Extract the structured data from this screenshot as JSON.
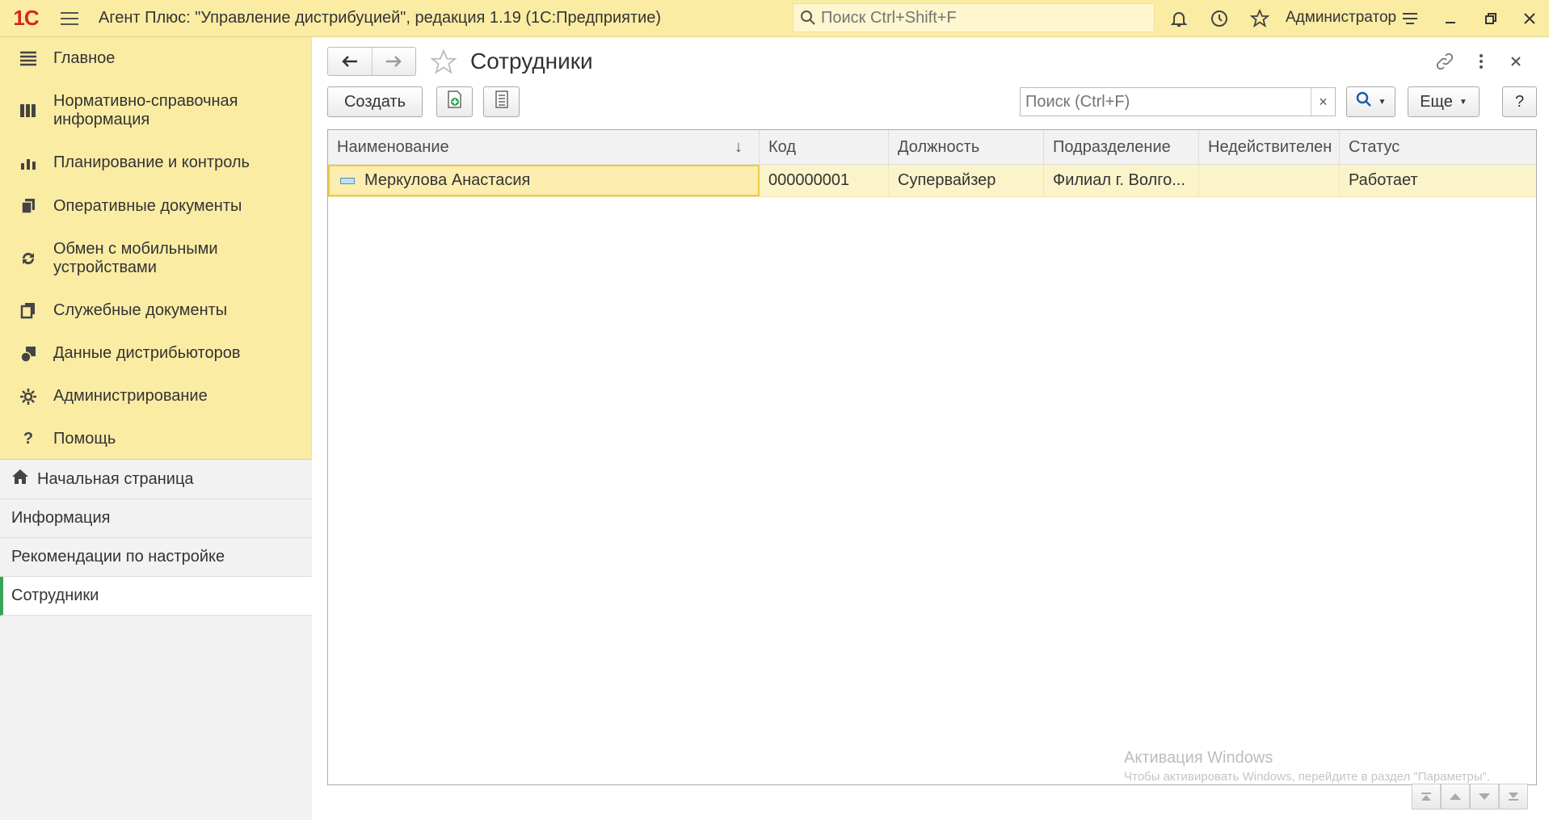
{
  "titlebar": {
    "logo": "1С",
    "title": "Агент Плюс: \"Управление дистрибуцией\", редакция 1.19  (1С:Предприятие)",
    "search_placeholder": "Поиск Ctrl+Shift+F",
    "user": "Администратор"
  },
  "sidebar": {
    "sections": [
      {
        "label": "Главное",
        "icon": "menu-lines-icon"
      },
      {
        "label": "Нормативно-справочная информация",
        "icon": "catalog-icon"
      },
      {
        "label": "Планирование и контроль",
        "icon": "chart-icon"
      },
      {
        "label": "Оперативные документы",
        "icon": "documents-icon"
      },
      {
        "label": "Обмен с мобильными устройствами",
        "icon": "sync-icon"
      },
      {
        "label": "Служебные документы",
        "icon": "service-docs-icon"
      },
      {
        "label": "Данные дистрибьюторов",
        "icon": "distributor-icon"
      },
      {
        "label": "Администрирование",
        "icon": "gear-icon"
      },
      {
        "label": "Помощь",
        "icon": "help-icon"
      }
    ],
    "open_windows": [
      {
        "label": "Начальная страница"
      },
      {
        "label": "Информация"
      },
      {
        "label": "Рекомендации по настройке"
      },
      {
        "label": "Сотрудники"
      }
    ]
  },
  "form": {
    "title": "Сотрудники",
    "create_label": "Создать",
    "search_placeholder": "Поиск (Ctrl+F)",
    "more_label": "Еще",
    "help_label": "?",
    "clear_label": "×"
  },
  "table": {
    "columns": [
      "Наименование",
      "Код",
      "Должность",
      "Подразделение",
      "Недействителен",
      "Статус"
    ],
    "rows": [
      {
        "name": "Меркулова Анастасия",
        "code": "000000001",
        "position": "Супервайзер",
        "department": "Филиал г. Волго...",
        "invalid": "",
        "status": "Работает"
      }
    ]
  },
  "watermark": {
    "line1": "Активация Windows",
    "line2": "Чтобы активировать Windows, перейдите в раздел \"Параметры\"."
  }
}
